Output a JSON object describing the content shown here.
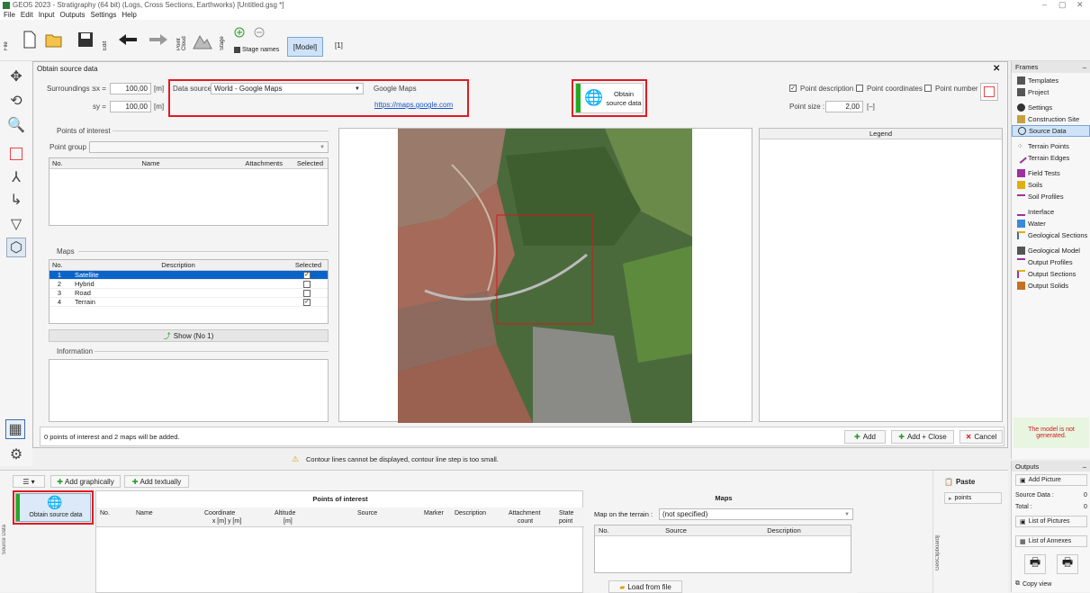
{
  "window": {
    "title": "GEO5 2023 - Stratigraphy (64 bit) (Logs, Cross Sections, Earthworks) [Untitled.gsg *]"
  },
  "menu": [
    "File",
    "Edit",
    "Input",
    "Outputs",
    "Settings",
    "Help"
  ],
  "toolbar": {
    "file_tab": "File",
    "edit_tab": "Edit",
    "point_cloud": "Point Cloud",
    "stage": "Stage",
    "stage_names": "Stage names",
    "model": "[Model]",
    "stage_num": "[1]"
  },
  "dialog": {
    "title": "Obtain source data",
    "surroundings_label": "Surroundings :",
    "sx_label": "sx =",
    "sy_label": "sy =",
    "sx_value": "100,00",
    "sy_value": "100,00",
    "unit_m": "[m]",
    "data_source_label": "Data source :",
    "data_source_value": "World - Google Maps",
    "gm_label": "Google Maps",
    "gm_link": "https://maps.google.com",
    "obtain_label_1": "Obtain",
    "obtain_label_2": "source data",
    "point_description": "Point description",
    "point_coordinates": "Point coordinates",
    "point_number": "Point number",
    "point_size_label": "Point size :",
    "point_size_value": "2,00",
    "point_size_unit": "[–]",
    "poi_section": "Points of interest",
    "point_group_label": "Point group :",
    "poi_headers": [
      "No.",
      "Name",
      "Attachments",
      "Selected"
    ],
    "maps_section": "Maps",
    "maps_headers": [
      "No.",
      "Description",
      "Selected"
    ],
    "maps": [
      {
        "no": "1",
        "desc": "Satellite",
        "checked": "✓"
      },
      {
        "no": "2",
        "desc": "Hybrid",
        "checked": ""
      },
      {
        "no": "3",
        "desc": "Road",
        "checked": ""
      },
      {
        "no": "4",
        "desc": "Terrain",
        "checked": "✓"
      }
    ],
    "show_button": "Show (No 1)",
    "info_section": "Information",
    "legend": "Legend",
    "status": "0 points of interest and 2 maps will be added.",
    "add": "Add",
    "add_close": "Add + Close",
    "cancel": "Cancel"
  },
  "contour_warning": "Contour lines cannot be displayed, contour line step is too small.",
  "bottom": {
    "add_graphically": "Add graphically",
    "add_textually": "Add textually",
    "obtain_source_data": "Obtain source data",
    "poi_title": "Points of interest",
    "poi_cols": [
      "No.",
      "Name",
      "Coordinate",
      "Altitude",
      "Source",
      "Marker",
      "Description",
      "Attachment",
      "State"
    ],
    "poi_cols_sub": [
      "",
      "",
      "x [m]   y [m]",
      "[m]",
      "",
      "",
      "",
      "count",
      "point"
    ],
    "maps_title": "Maps",
    "map_on_terrain_label": "Map on the terrain :",
    "map_on_terrain_value": "(not specified)",
    "maps_cols": [
      "No.",
      "Source",
      "Description"
    ],
    "load_from_file": "Load from file",
    "source_data_side": "Source Data",
    "geo_clipboard": "GeoClipboard™"
  },
  "frames": {
    "title": "Frames",
    "items": [
      "Templates",
      "Project",
      "Settings",
      "Construction Site",
      "Source Data",
      "Terrain Points",
      "Terrain Edges",
      "Field Tests",
      "Soils",
      "Soil Profiles",
      "Interface",
      "Water",
      "Geological Sections",
      "Geological Model",
      "Output Profiles",
      "Output Sections",
      "Output Solids"
    ],
    "model_not_generated": "The model is not generated."
  },
  "outputs": {
    "title": "Outputs",
    "add_picture": "Add Picture",
    "source_data_label": "Source Data :",
    "source_data_count": "0",
    "total_label": "Total :",
    "total_count": "0",
    "list_of_pictures": "List of Pictures",
    "list_of_annexes": "List of Annexes",
    "copy_view": "Copy view"
  },
  "clipboard": {
    "paste": "Paste",
    "points": "points"
  },
  "colors": {
    "accent_red": "#e01a22",
    "green": "#22aa22",
    "selection": "#0a64c8"
  }
}
